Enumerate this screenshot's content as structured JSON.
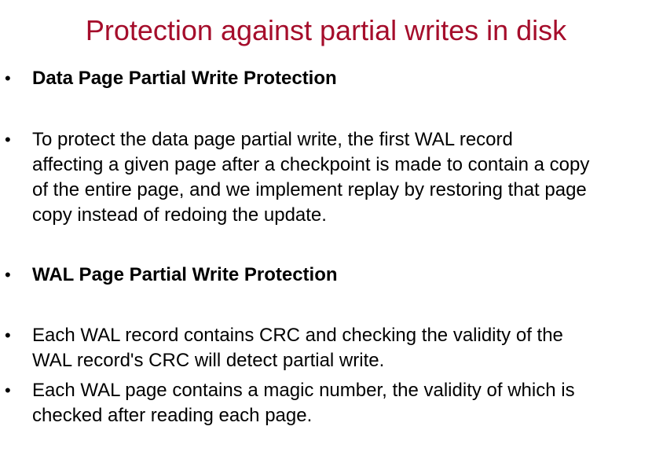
{
  "title": "Protection against partial writes in disk",
  "bullet_symbol": "•",
  "bullets": [
    {
      "text": "Data Page Partial Write Protection",
      "bold": true
    },
    {
      "text": "To protect the data page partial write, the first WAL record\naffecting a given page after a checkpoint is made to contain a copy\nof the entire page, and we implement replay by restoring that page\ncopy instead of redoing the update.",
      "bold": false
    },
    {
      "text": "WAL Page Partial Write Protection",
      "bold": true
    },
    {
      "text": "Each WAL record contains CRC and checking the validity of the\nWAL record's CRC will detect partial write.",
      "bold": false
    },
    {
      "text": "Each WAL page contains a magic number, the validity of which is\nchecked after reading each page.",
      "bold": false
    }
  ],
  "colors": {
    "title": "#a50d2b",
    "text": "#000000",
    "background": "#ffffff"
  }
}
